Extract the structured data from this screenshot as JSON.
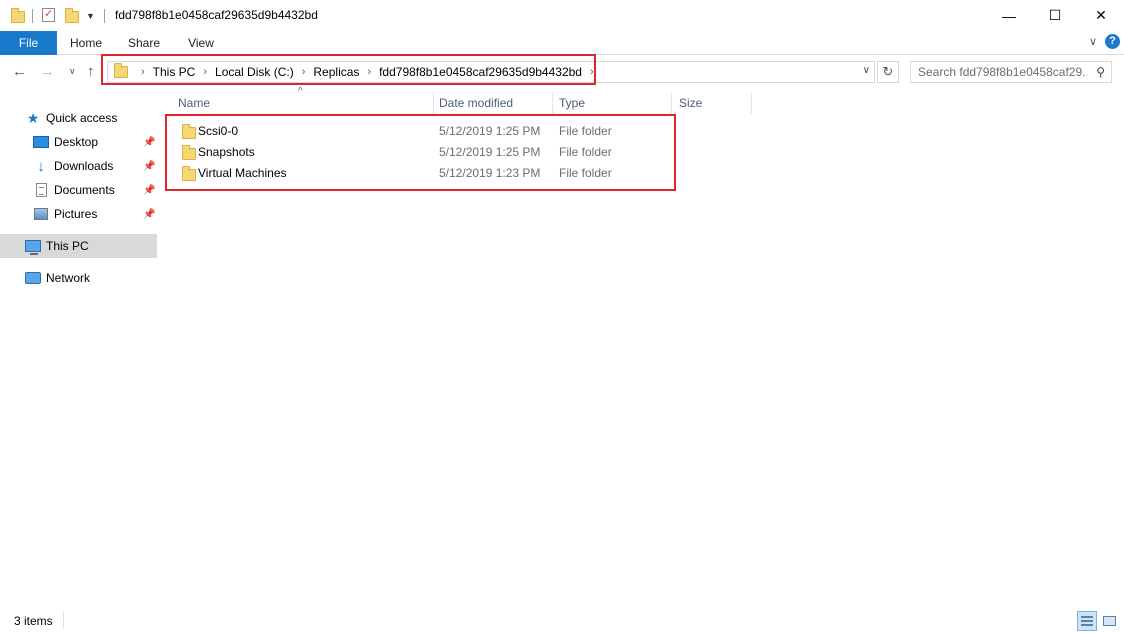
{
  "window": {
    "title": "fdd798f8b1e0458caf29635d9b4432bd",
    "minimize_glyph": "—",
    "maximize_glyph": "☐",
    "close_glyph": "✕"
  },
  "ribbon": {
    "tabs": [
      {
        "label": "File"
      },
      {
        "label": "Home"
      },
      {
        "label": "Share"
      },
      {
        "label": "View"
      }
    ],
    "help_glyph": "?"
  },
  "address_bar": {
    "crumbs": [
      "This PC",
      "Local Disk (C:)",
      "Replicas",
      "fdd798f8b1e0458caf29635d9b4432bd"
    ]
  },
  "search": {
    "placeholder": "Search fdd798f8b1e0458caf29..."
  },
  "nav_pane": {
    "quick_access": "Quick access",
    "items": [
      {
        "label": "Desktop",
        "icon": "desktop-icon",
        "pinned": true
      },
      {
        "label": "Downloads",
        "icon": "downloads-icon",
        "pinned": true
      },
      {
        "label": "Documents",
        "icon": "documents-icon",
        "pinned": true
      },
      {
        "label": "Pictures",
        "icon": "pictures-icon",
        "pinned": true
      }
    ],
    "this_pc": "This PC",
    "network": "Network"
  },
  "file_list": {
    "columns": [
      "Name",
      "Date modified",
      "Type",
      "Size"
    ],
    "rows": [
      {
        "name": "Scsi0-0",
        "date": "5/12/2019 1:25 PM",
        "type": "File folder"
      },
      {
        "name": "Snapshots",
        "date": "5/12/2019 1:25 PM",
        "type": "File folder"
      },
      {
        "name": "Virtual Machines",
        "date": "5/12/2019 1:23 PM",
        "type": "File folder"
      }
    ]
  },
  "status_bar": {
    "item_count": "3 items"
  },
  "colors": {
    "accent": "#1979ca",
    "highlight_box": "#e0262c",
    "selected_nav": "#d9d9d9"
  }
}
